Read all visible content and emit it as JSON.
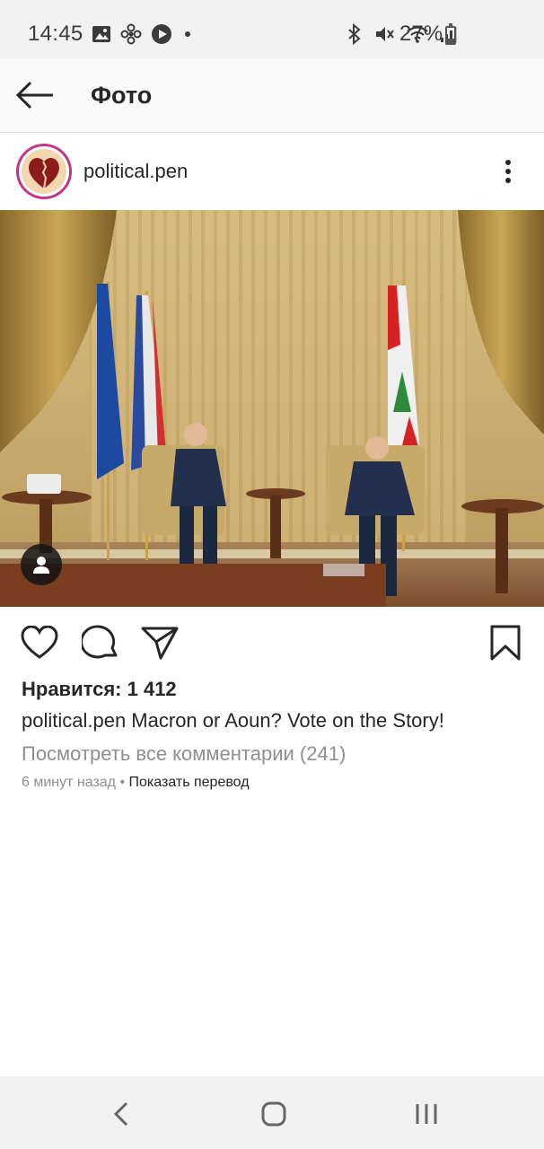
{
  "status_bar": {
    "time": "14:45",
    "battery": "27%",
    "battery_level": 0.27,
    "left_icons": [
      "image-icon",
      "fan-icon",
      "play-icon",
      "dot-icon"
    ],
    "right_icons": [
      "bluetooth-icon",
      "mute-icon",
      "wifi-icon",
      "signal-icon"
    ]
  },
  "header": {
    "title": "Фото",
    "back_icon": "arrow-left-icon"
  },
  "post": {
    "username": "political.pen",
    "likes": "Нравится: 1 412",
    "caption_user": "political.pen",
    "caption_text": " Macron or Aoun? Vote on the Story!",
    "view_comments": "Посмотреть все комментарии (241)",
    "time_ago": "6 минут назад",
    "separator": " • ",
    "translate": "Показать перевод"
  },
  "actions": {
    "like_icon": "heart-icon",
    "comment_icon": "comment-icon",
    "share_icon": "send-icon",
    "save_icon": "bookmark-icon"
  },
  "colors": {
    "text": "#262626",
    "secondary": "#8e8e8e",
    "avatar_ring": "#c13584"
  },
  "nav": {
    "back_icon": "nav-back-icon",
    "home_icon": "nav-home-icon",
    "recents_icon": "nav-recents-icon"
  }
}
